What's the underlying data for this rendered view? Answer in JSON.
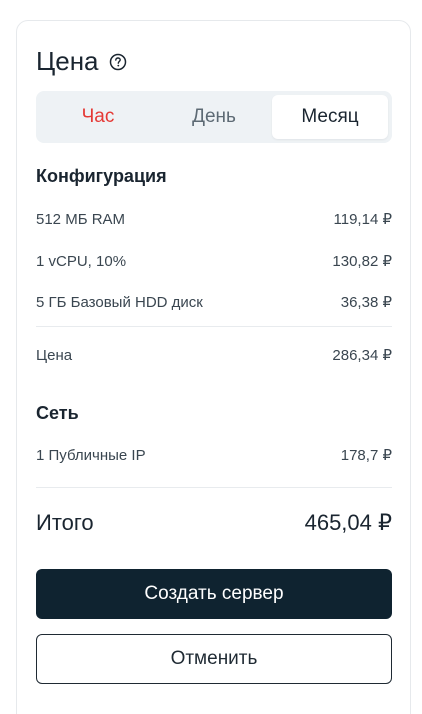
{
  "price": {
    "title": "Цена",
    "help_icon": "question-circle-icon"
  },
  "tabs": [
    {
      "label": "Час",
      "state": "highlighted"
    },
    {
      "label": "День",
      "state": "normal"
    },
    {
      "label": "Месяц",
      "state": "selected"
    }
  ],
  "configuration": {
    "title": "Конфигурация",
    "items": [
      {
        "label": "512 МБ RAM",
        "value": "119,14 ₽"
      },
      {
        "label": "1 vCPU, 10%",
        "value": "130,82 ₽"
      },
      {
        "label": "5 ГБ Базовый HDD диск",
        "value": "36,38 ₽"
      }
    ],
    "subtotal": {
      "label": "Цена",
      "value": "286,34 ₽"
    }
  },
  "network": {
    "title": "Сеть",
    "items": [
      {
        "label": "1 Публичные IP",
        "value": "178,7 ₽"
      }
    ]
  },
  "total": {
    "label": "Итого",
    "value": "465,04 ₽"
  },
  "actions": {
    "create_label": "Создать сервер",
    "cancel_label": "Отменить"
  },
  "colors": {
    "accent_red": "#e53935",
    "primary_button": "#0f2330"
  }
}
